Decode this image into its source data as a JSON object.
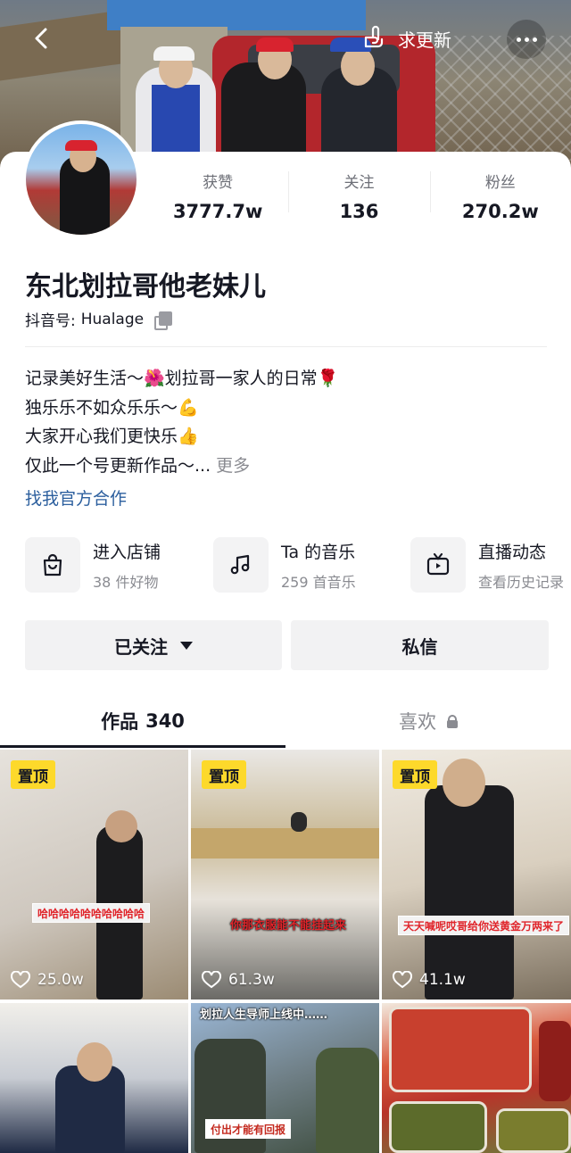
{
  "header": {
    "update_label": "求更新"
  },
  "stats": [
    {
      "label": "获赞",
      "value": "3777.7w"
    },
    {
      "label": "关注",
      "value": "136"
    },
    {
      "label": "粉丝",
      "value": "270.2w"
    }
  ],
  "profile": {
    "nickname": "东北划拉哥他老妹儿",
    "douyin_id_label": "抖音号:",
    "douyin_id": "Hualage",
    "bio": [
      "记录美好生活～🌺划拉哥一家人的日常🌹",
      "独乐乐不如众乐乐～💪",
      "大家开心我们更快乐👍",
      "仅此一个号更新作品～..."
    ],
    "bio_more": "更多",
    "official_link": "找我官方合作"
  },
  "shortcuts": [
    {
      "title": "进入店铺",
      "subtitle": "38 件好物",
      "icon": "shopping-bag-icon"
    },
    {
      "title": "Ta 的音乐",
      "subtitle": "259 首音乐",
      "icon": "music-note-icon"
    },
    {
      "title": "直播动态",
      "subtitle": "查看历史记录",
      "icon": "tv-icon"
    }
  ],
  "actions": {
    "follow_label": "已关注",
    "message_label": "私信"
  },
  "tabs": {
    "works_label": "作品",
    "works_count": "340",
    "likes_label": "喜欢"
  },
  "videos": [
    {
      "pinned": "置顶",
      "caption": "哈哈哈哈哈哈哈哈哈哈",
      "likes": "25.0w"
    },
    {
      "pinned": "置顶",
      "caption": "你那衣服能不能挂起来",
      "likes": "61.3w"
    },
    {
      "pinned": "置顶",
      "caption": "天天喊呢哎哥给你送黄金万两来了",
      "likes": "41.1w"
    },
    {
      "caption": ""
    },
    {
      "caption_top": "划拉人生导师上线中……",
      "caption": "付出才能有回报"
    },
    {
      "caption": ""
    }
  ],
  "colors": {
    "pinned_badge": "#fdd92b",
    "link": "#2c5f9e",
    "caption_red": "#e0252b"
  }
}
